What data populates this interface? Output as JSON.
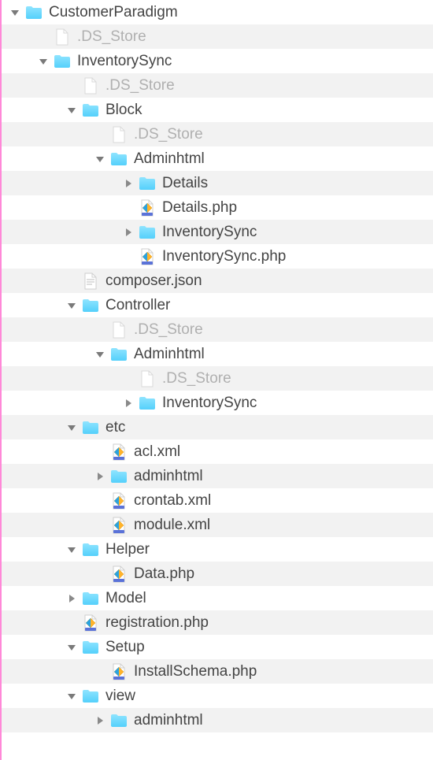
{
  "rows": [
    {
      "depth": 0,
      "stripe": false,
      "disclosure": "open",
      "icon": "folder",
      "label": "CustomerParadigm",
      "dim": false,
      "name": "folder-customerparadigm"
    },
    {
      "depth": 1,
      "stripe": true,
      "disclosure": "none",
      "icon": "blank",
      "label": ".DS_Store",
      "dim": true,
      "name": "file-ds-store"
    },
    {
      "depth": 1,
      "stripe": false,
      "disclosure": "open",
      "icon": "folder",
      "label": "InventorySync",
      "dim": false,
      "name": "folder-inventorysync"
    },
    {
      "depth": 2,
      "stripe": true,
      "disclosure": "none",
      "icon": "blank",
      "label": ".DS_Store",
      "dim": true,
      "name": "file-ds-store"
    },
    {
      "depth": 2,
      "stripe": false,
      "disclosure": "open",
      "icon": "folder",
      "label": "Block",
      "dim": false,
      "name": "folder-block"
    },
    {
      "depth": 3,
      "stripe": true,
      "disclosure": "none",
      "icon": "blank",
      "label": ".DS_Store",
      "dim": true,
      "name": "file-ds-store"
    },
    {
      "depth": 3,
      "stripe": false,
      "disclosure": "open",
      "icon": "folder",
      "label": "Adminhtml",
      "dim": false,
      "name": "folder-adminhtml"
    },
    {
      "depth": 4,
      "stripe": true,
      "disclosure": "closed",
      "icon": "folder",
      "label": "Details",
      "dim": false,
      "name": "folder-details"
    },
    {
      "depth": 4,
      "stripe": false,
      "disclosure": "none",
      "icon": "php",
      "label": "Details.php",
      "dim": false,
      "name": "file-details-php"
    },
    {
      "depth": 4,
      "stripe": true,
      "disclosure": "closed",
      "icon": "folder",
      "label": "InventorySync",
      "dim": false,
      "name": "folder-inventorysync-block"
    },
    {
      "depth": 4,
      "stripe": false,
      "disclosure": "none",
      "icon": "php",
      "label": "InventorySync.php",
      "dim": false,
      "name": "file-inventorysync-php"
    },
    {
      "depth": 2,
      "stripe": true,
      "disclosure": "none",
      "icon": "text",
      "label": "composer.json",
      "dim": false,
      "name": "file-composer-json"
    },
    {
      "depth": 2,
      "stripe": false,
      "disclosure": "open",
      "icon": "folder",
      "label": "Controller",
      "dim": false,
      "name": "folder-controller"
    },
    {
      "depth": 3,
      "stripe": true,
      "disclosure": "none",
      "icon": "blank",
      "label": ".DS_Store",
      "dim": true,
      "name": "file-ds-store"
    },
    {
      "depth": 3,
      "stripe": false,
      "disclosure": "open",
      "icon": "folder",
      "label": "Adminhtml",
      "dim": false,
      "name": "folder-adminhtml-controller"
    },
    {
      "depth": 4,
      "stripe": true,
      "disclosure": "none",
      "icon": "blank",
      "label": ".DS_Store",
      "dim": true,
      "name": "file-ds-store"
    },
    {
      "depth": 4,
      "stripe": false,
      "disclosure": "closed",
      "icon": "folder",
      "label": "InventorySync",
      "dim": false,
      "name": "folder-inventorysync-controller"
    },
    {
      "depth": 2,
      "stripe": true,
      "disclosure": "open",
      "icon": "folder",
      "label": "etc",
      "dim": false,
      "name": "folder-etc"
    },
    {
      "depth": 3,
      "stripe": false,
      "disclosure": "none",
      "icon": "php",
      "label": "acl.xml",
      "dim": false,
      "name": "file-acl-xml"
    },
    {
      "depth": 3,
      "stripe": true,
      "disclosure": "closed",
      "icon": "folder",
      "label": "adminhtml",
      "dim": false,
      "name": "folder-adminhtml-etc"
    },
    {
      "depth": 3,
      "stripe": false,
      "disclosure": "none",
      "icon": "php",
      "label": "crontab.xml",
      "dim": false,
      "name": "file-crontab-xml"
    },
    {
      "depth": 3,
      "stripe": true,
      "disclosure": "none",
      "icon": "php",
      "label": "module.xml",
      "dim": false,
      "name": "file-module-xml"
    },
    {
      "depth": 2,
      "stripe": false,
      "disclosure": "open",
      "icon": "folder",
      "label": "Helper",
      "dim": false,
      "name": "folder-helper"
    },
    {
      "depth": 3,
      "stripe": true,
      "disclosure": "none",
      "icon": "php",
      "label": "Data.php",
      "dim": false,
      "name": "file-data-php"
    },
    {
      "depth": 2,
      "stripe": false,
      "disclosure": "closed",
      "icon": "folder",
      "label": "Model",
      "dim": false,
      "name": "folder-model"
    },
    {
      "depth": 2,
      "stripe": true,
      "disclosure": "none",
      "icon": "php",
      "label": "registration.php",
      "dim": false,
      "name": "file-registration-php"
    },
    {
      "depth": 2,
      "stripe": false,
      "disclosure": "open",
      "icon": "folder",
      "label": "Setup",
      "dim": false,
      "name": "folder-setup"
    },
    {
      "depth": 3,
      "stripe": true,
      "disclosure": "none",
      "icon": "php",
      "label": "InstallSchema.php",
      "dim": false,
      "name": "file-installschema-php"
    },
    {
      "depth": 2,
      "stripe": false,
      "disclosure": "open",
      "icon": "folder",
      "label": "view",
      "dim": false,
      "name": "folder-view"
    },
    {
      "depth": 3,
      "stripe": true,
      "disclosure": "closed",
      "icon": "folder",
      "label": "adminhtml",
      "dim": false,
      "name": "folder-adminhtml-view"
    }
  ],
  "indentBase": 10,
  "indentStep": 36
}
